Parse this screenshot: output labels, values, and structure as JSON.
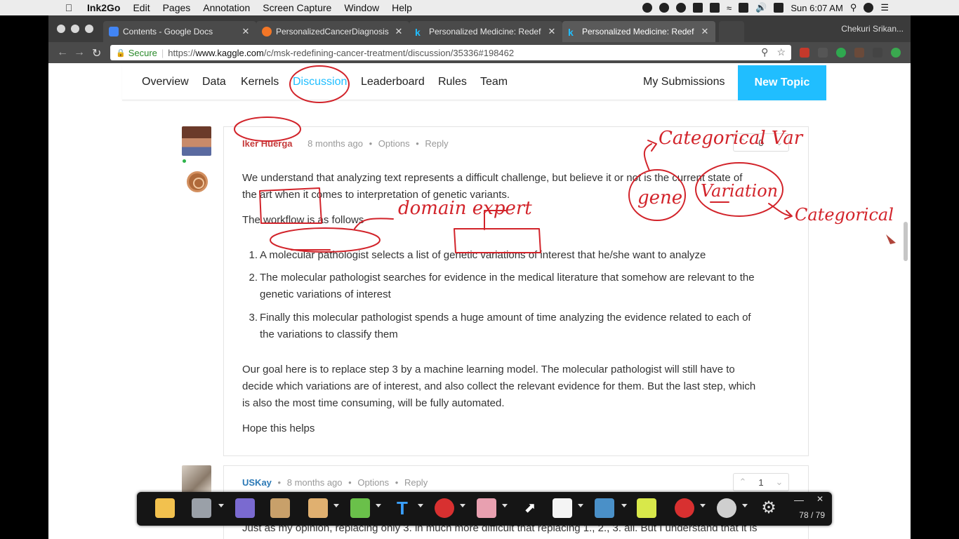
{
  "menubar": {
    "app": "Ink2Go",
    "items": [
      "Edit",
      "Pages",
      "Annotation",
      "Screen Capture",
      "Window",
      "Help"
    ],
    "clock": "Sun 6:07 AM"
  },
  "browser": {
    "tabs": [
      {
        "label": "Contents - Google Docs",
        "color": "#4285f4"
      },
      {
        "label": "PersonalizedCancerDiagnosis",
        "color": "#f37626"
      },
      {
        "label": "Personalized Medicine: Redef",
        "color": "#20beff"
      },
      {
        "label": "Personalized Medicine: Redef",
        "color": "#20beff"
      }
    ],
    "profile": "Chekuri Srikan...",
    "secure_label": "Secure",
    "url_prefix": "https://",
    "url_host": "www.kaggle.com",
    "url_path": "/c/msk-redefining-cancer-treatment/discussion/35336#198462"
  },
  "nav": {
    "links": [
      "Overview",
      "Data",
      "Kernels",
      "Discussion",
      "Leaderboard",
      "Rules",
      "Team"
    ],
    "my_submissions": "My Submissions",
    "new_topic": "New Topic"
  },
  "comment1": {
    "author": "Iker Huerga",
    "time": "8 months ago",
    "options": "Options",
    "reply": "Reply",
    "votes": "0",
    "p1": "We understand that analyzing text represents a difficult challenge, but believe it or not is the current state of",
    "p1b": "the art when it comes to interpretation of genetic variants.",
    "p2": "The workflow is as follows",
    "items": [
      {
        "num": "1.",
        "lines": [
          "A molecular pathologist selects a list of genetic variations of interest that he/she want to analyze"
        ]
      },
      {
        "num": "2.",
        "lines": [
          "The molecular pathologist searches for evidence in the medical literature that somehow are relevant to the",
          "genetic variations of interest"
        ]
      },
      {
        "num": "3.",
        "lines": [
          "Finally this molecular pathologist spends a huge amount of time analyzing the evidence related to each of",
          "the variations to classify them"
        ]
      }
    ],
    "p3": [
      "Our goal here is to replace step 3 by a machine learning model. The molecular pathologist will still have to",
      "decide which variations are of interest, and also collect the relevant evidence for them. But the last step, which",
      "is also the most time consuming, will be fully automated."
    ],
    "p4": "Hope this helps"
  },
  "comment2": {
    "author": "USKay",
    "time": "8 months ago",
    "options": "Options",
    "reply": "Reply",
    "votes": "1",
    "cut_text": "Just as my opinion, replacing only 3. in much more difficult that replacing 1., 2., 3. all. But I understand that it is"
  },
  "annotations": {
    "domain_expert": "domain expert",
    "categorical_var": "Categorical Var",
    "gene": "gene",
    "variation": "Variation",
    "categorical": "Categorical"
  },
  "inkbar": {
    "page_counter": "78 / 79"
  }
}
